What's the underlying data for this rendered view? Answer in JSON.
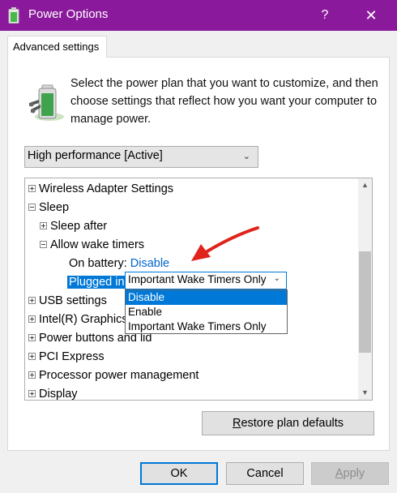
{
  "window": {
    "title": "Power Options",
    "help_label": "?",
    "close_label": "✕",
    "title_bar_color": "#8a1a9b"
  },
  "tab": {
    "label": "Advanced settings"
  },
  "description": "Select the power plan that you want to customize, and then choose settings that reflect how you want your computer to manage power.",
  "plan_select": {
    "value": "High performance [Active]"
  },
  "tree": {
    "items": [
      {
        "label": "Wireless Adapter Settings"
      },
      {
        "label": "Sleep"
      },
      {
        "label": "Sleep after"
      },
      {
        "label": "Allow wake timers"
      },
      {
        "label": "On battery:",
        "value": "Disable"
      },
      {
        "label": "Plugged in:"
      },
      {
        "label": "USB settings"
      },
      {
        "label": "Intel(R) Graphics"
      },
      {
        "label": "Power buttons and lid"
      },
      {
        "label": "PCI Express"
      },
      {
        "label": "Processor power management"
      },
      {
        "label": "Display"
      }
    ]
  },
  "value_select": {
    "value": "Important Wake Timers Only",
    "options": [
      {
        "label": "Disable",
        "selected": true
      },
      {
        "label": "Enable"
      },
      {
        "label": "Important Wake Timers Only"
      }
    ]
  },
  "buttons": {
    "restore": {
      "underline_letter": "R",
      "rest": "estore plan defaults"
    },
    "ok": "OK",
    "cancel": "Cancel",
    "apply": {
      "underline_letter": "A",
      "rest": "pply"
    }
  },
  "colors": {
    "accent": "#0078d7",
    "link": "#0066cc",
    "annotation_arrow": "#e0231b"
  }
}
